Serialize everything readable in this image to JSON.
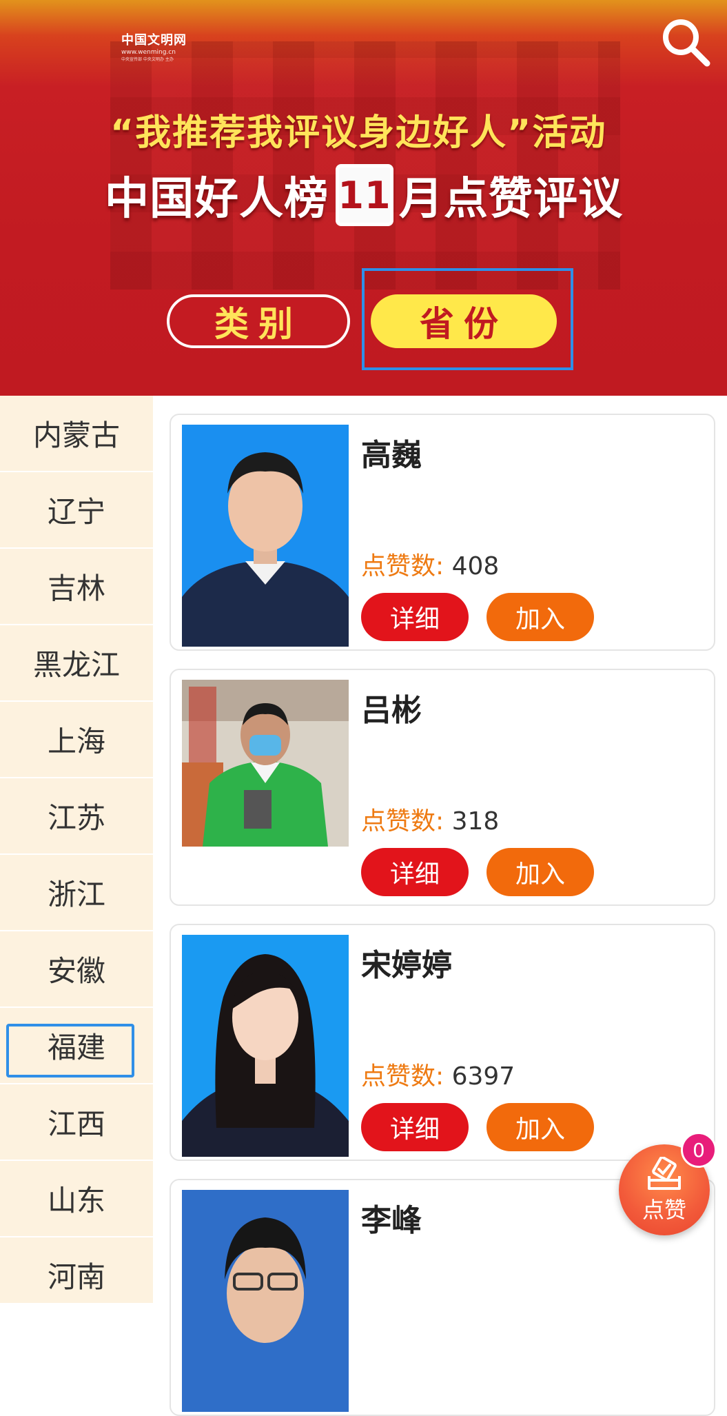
{
  "banner": {
    "logo_main": "中国文明网",
    "logo_sub": "www.wenming.cn",
    "logo_small": "中央宣传部 中央文明办 主办",
    "headline_line1": "“我推荐我评议身边好人”活动",
    "headline_prefix": "中国好人榜",
    "headline_month": "11",
    "headline_suffix": "月点赞评议",
    "tab_category": "类别",
    "tab_province": "省份"
  },
  "sidebar": {
    "items": [
      {
        "label": "内蒙古"
      },
      {
        "label": "辽宁"
      },
      {
        "label": "吉林"
      },
      {
        "label": "黑龙江"
      },
      {
        "label": "上海"
      },
      {
        "label": "江苏"
      },
      {
        "label": "浙江"
      },
      {
        "label": "安徽"
      },
      {
        "label": "福建"
      },
      {
        "label": "江西"
      },
      {
        "label": "山东"
      },
      {
        "label": "河南"
      }
    ],
    "selected": "福建"
  },
  "labels": {
    "likes": "点赞数:",
    "detail_button": "详细",
    "join_button": "加入"
  },
  "cards": [
    {
      "name": "高巍",
      "likes": "408"
    },
    {
      "name": "吕彬",
      "likes": "318"
    },
    {
      "name": "宋婷婷",
      "likes": "6397"
    },
    {
      "name": "李峰"
    }
  ],
  "fab": {
    "label": "点赞",
    "badge": "0"
  },
  "icons": {
    "search": "search-icon",
    "like": "ballot-box-icon"
  },
  "colors": {
    "banner_red": "#c21b22",
    "highlight_yellow": "#ffe84a",
    "detail_red": "#e2141b",
    "join_orange": "#f26a0c",
    "likes_orange": "#ee7a12",
    "sidebar_bg": "#fdf2df",
    "focus_blue": "#2f8fe8",
    "badge_pink": "#e81d7a"
  }
}
